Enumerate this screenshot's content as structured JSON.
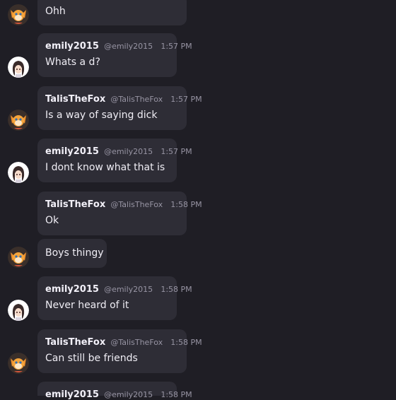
{
  "messages": [
    {
      "author": "",
      "handle": "",
      "time": "",
      "text": "Ohh",
      "avatar": "tails-fox-icon"
    },
    {
      "author": "emily2015",
      "handle": "@emily2015",
      "time": "1:57 PM",
      "text": "Whats a d?",
      "avatar": "anime-girl-icon"
    },
    {
      "author": "TalisTheFox",
      "handle": "@TalisTheFox",
      "time": "1:57 PM",
      "text": "Is a way of saying dick",
      "avatar": "tails-fox-icon"
    },
    {
      "author": "emily2015",
      "handle": "@emily2015",
      "time": "1:57 PM",
      "text": "I dont know what that is",
      "avatar": "anime-girl-icon"
    },
    {
      "author": "TalisTheFox",
      "handle": "@TalisTheFox",
      "time": "1:58 PM",
      "text": "Ok",
      "avatar": ""
    },
    {
      "author": "",
      "handle": "",
      "time": "",
      "text": "Boys thingy",
      "avatar": "tails-fox-icon"
    },
    {
      "author": "emily2015",
      "handle": "@emily2015",
      "time": "1:58 PM",
      "text": "Never heard of it",
      "avatar": "anime-girl-icon"
    },
    {
      "author": "TalisTheFox",
      "handle": "@TalisTheFox",
      "time": "1:58 PM",
      "text": "Can still be friends",
      "avatar": "tails-fox-icon"
    },
    {
      "author": "emily2015",
      "handle": "@emily2015",
      "time": "1:58 PM",
      "text": "",
      "avatar": ""
    }
  ]
}
